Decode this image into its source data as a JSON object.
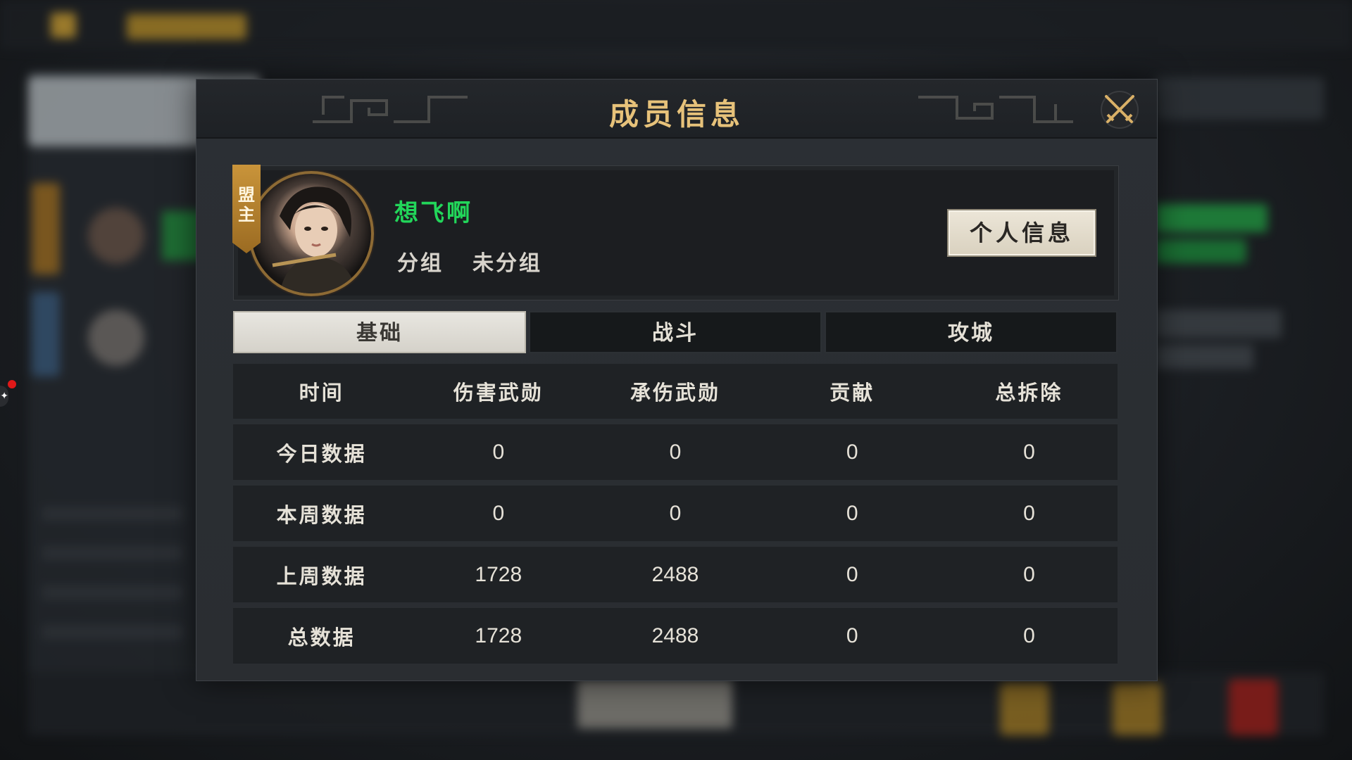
{
  "modal": {
    "title": "成员信息"
  },
  "profile": {
    "role_badge": "盟主",
    "name": "想飞啊",
    "group_label": "分组",
    "group_value": "未分组",
    "info_button": "个人信息"
  },
  "tabs": [
    {
      "label": "基础",
      "active": true
    },
    {
      "label": "战斗",
      "active": false
    },
    {
      "label": "攻城",
      "active": false
    }
  ],
  "table": {
    "headers": [
      "时间",
      "伤害武勋",
      "承伤武勋",
      "贡献",
      "总拆除"
    ],
    "rows": [
      {
        "label": "今日数据",
        "values": [
          "0",
          "0",
          "0",
          "0"
        ]
      },
      {
        "label": "本周数据",
        "values": [
          "0",
          "0",
          "0",
          "0"
        ]
      },
      {
        "label": "上周数据",
        "values": [
          "1728",
          "2488",
          "0",
          "0"
        ]
      },
      {
        "label": "总数据",
        "values": [
          "1728",
          "2488",
          "0",
          "0"
        ]
      }
    ]
  },
  "colors": {
    "title_gold": "#e7c27a",
    "name_green": "#22d65a",
    "badge_gold": "#c9943a"
  },
  "icons": {
    "close": "crossed-swords-icon"
  }
}
